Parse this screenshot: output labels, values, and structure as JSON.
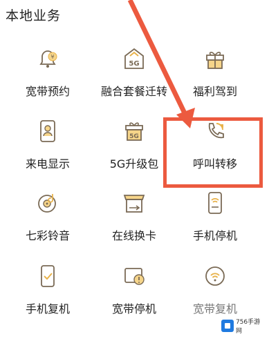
{
  "section": {
    "title": "本地业务"
  },
  "services": [
    {
      "label": "宽带预约",
      "icon": "bell-yen-icon"
    },
    {
      "label": "融合套餐迁转",
      "icon": "5g-upgrade-icon"
    },
    {
      "label": "福利驾到",
      "icon": "gift-icon"
    },
    {
      "label": "来电显示",
      "icon": "caller-id-icon"
    },
    {
      "label": "5G升级包",
      "icon": "5g-package-icon"
    },
    {
      "label": "呼叫转移",
      "icon": "call-forward-icon"
    },
    {
      "label": "七彩铃音",
      "icon": "ringtone-disc-icon"
    },
    {
      "label": "在线换卡",
      "icon": "sim-swap-icon"
    },
    {
      "label": "手机停机",
      "icon": "phone-suspend-icon"
    },
    {
      "label": "手机复机",
      "icon": "phone-resume-icon"
    },
    {
      "label": "宽带停机",
      "icon": "broadband-suspend-icon"
    },
    {
      "label": "宽带复机",
      "icon": "broadband-resume-icon"
    }
  ],
  "colors": {
    "icon_accent": "#e8b24a",
    "icon_stroke": "#7a6a55",
    "highlight": "#ec5a3f"
  },
  "watermark": {
    "text": "756手游网"
  }
}
